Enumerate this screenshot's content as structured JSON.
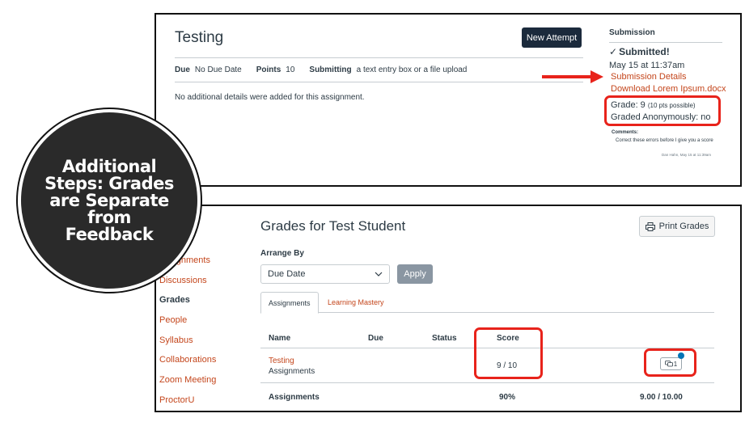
{
  "assignment": {
    "title": "Testing",
    "new_attempt_label": "New Attempt",
    "due_label": "Due",
    "due_value": "No Due Date",
    "points_label": "Points",
    "points_value": "10",
    "submitting_label": "Submitting",
    "submitting_value": "a text entry box or a file upload",
    "details_text": "No additional details were added for this assignment."
  },
  "submission": {
    "heading": "Submission",
    "status_check": "✓",
    "status": "Submitted!",
    "date": "May 15 at 11:37am",
    "details_link": "Submission Details",
    "download_link": "Download Lorem Ipsum.docx",
    "grade_label": "Grade: 9",
    "grade_possible": "(10 pts possible)",
    "graded_anonymously": "Graded Anonymously: no",
    "comments_label": "Comments:",
    "comment_text": "Correct these errors before I give you a score",
    "comment_meta": "Dan Hahn, May 15 at 11:39am"
  },
  "overlay": {
    "text": "Additional Steps: Grades are Separate from Feedback"
  },
  "grades": {
    "title": "Grades for Test Student",
    "print_label": "Print Grades",
    "arrange_label": "Arrange By",
    "arrange_value": "Due Date",
    "apply_label": "Apply",
    "tabs": [
      {
        "label": "Assignments"
      },
      {
        "label": "Learning Mastery"
      }
    ],
    "columns": {
      "name": "Name",
      "due": "Due",
      "status": "Status",
      "score": "Score"
    },
    "row": {
      "name": "Testing",
      "group": "Assignments",
      "score": "9 / 10",
      "comment_count": "1"
    },
    "total": {
      "label": "Assignments",
      "percent": "90%",
      "points": "9.00 / 10.00"
    }
  },
  "course_nav": [
    {
      "label": "Assignments"
    },
    {
      "label": "Discussions"
    },
    {
      "label": "Grades"
    },
    {
      "label": "People"
    },
    {
      "label": "Syllabus"
    },
    {
      "label": "Collaborations"
    },
    {
      "label": "Zoom Meeting"
    },
    {
      "label": "ProctorU"
    }
  ],
  "colors": {
    "link": "#c4461c",
    "highlight": "#e8231b",
    "primary_button": "#1b2a3c"
  }
}
